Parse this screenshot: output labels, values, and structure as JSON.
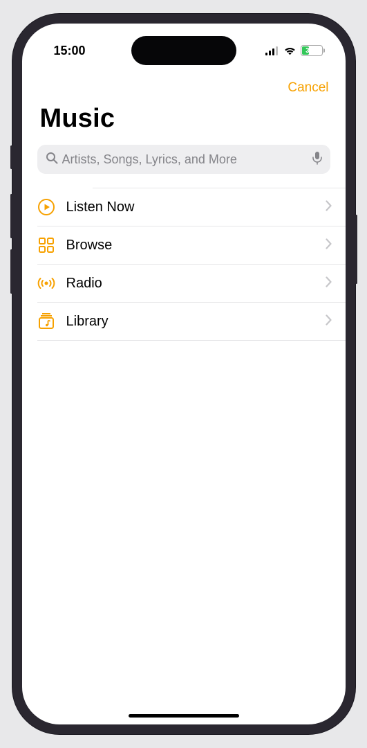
{
  "status": {
    "time": "15:00",
    "battery_pct": "35"
  },
  "nav": {
    "cancel": "Cancel"
  },
  "page_title": "Music",
  "search": {
    "placeholder": "Artists, Songs, Lyrics, and More"
  },
  "menu": [
    {
      "icon": "play-circle-icon",
      "label": "Listen Now"
    },
    {
      "icon": "grid-icon",
      "label": "Browse"
    },
    {
      "icon": "radio-icon",
      "label": "Radio"
    },
    {
      "icon": "library-icon",
      "label": "Library"
    }
  ],
  "colors": {
    "accent": "#f7a100",
    "battery_fill": "#33c759"
  }
}
